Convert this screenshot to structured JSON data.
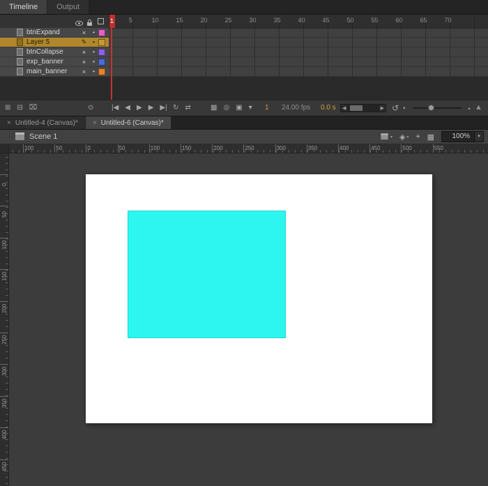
{
  "timeline": {
    "tabs": [
      {
        "label": "Timeline"
      },
      {
        "label": "Output"
      }
    ],
    "layers": [
      {
        "name": "btnExpand",
        "status_icon": "×",
        "dot": "•",
        "color": "#e060c8",
        "selected": false
      },
      {
        "name": "Layer 5",
        "status_icon": "✎",
        "dot": "•",
        "color": "#c49a35",
        "selected": true
      },
      {
        "name": "btnCollapse",
        "status_icon": "×",
        "dot": "•",
        "color": "#8f5fe8",
        "selected": false
      },
      {
        "name": "exp_banner",
        "status_icon": "×",
        "dot": "•",
        "color": "#4a6cd4",
        "selected": false
      },
      {
        "name": "main_banner",
        "status_icon": "×",
        "dot": "•",
        "color": "#e8822a",
        "selected": false
      }
    ],
    "frame_numbers": [
      5,
      10,
      15,
      20,
      25,
      30,
      35,
      40,
      45,
      50,
      55,
      60,
      65,
      70
    ],
    "status": {
      "current_frame": "1",
      "frame_rate": "24.00 fps",
      "elapsed_time": "0.0 s"
    }
  },
  "toolbar": {
    "left_group": [
      {
        "name": "new-layer-button",
        "glyph": "⊞"
      },
      {
        "name": "new-folder-button",
        "glyph": "⊟"
      },
      {
        "name": "delete-layer-button",
        "glyph": "⌧"
      }
    ],
    "marker_group": [
      {
        "name": "center-frame-button",
        "glyph": "⊙"
      }
    ],
    "playback_group": [
      {
        "name": "go-first-frame-button",
        "glyph": "|◀"
      },
      {
        "name": "step-back-button",
        "glyph": "◀"
      },
      {
        "name": "play-button",
        "glyph": "▶"
      },
      {
        "name": "step-forward-button",
        "glyph": "▶"
      },
      {
        "name": "go-last-frame-button",
        "glyph": "▶|"
      }
    ],
    "loop_group": [
      {
        "name": "loop-playback-button",
        "glyph": "↻"
      },
      {
        "name": "frame-range-button",
        "glyph": "⇄"
      }
    ],
    "onion_group": [
      {
        "name": "onion-skin-button",
        "glyph": "▩"
      },
      {
        "name": "onion-skin-outlines-button",
        "glyph": "◎"
      },
      {
        "name": "edit-multiple-frames-button",
        "glyph": "▣"
      },
      {
        "name": "modify-markers-button",
        "glyph": "▾"
      }
    ]
  },
  "document_tabs": [
    {
      "label": "Untitled-4 (Canvas)*",
      "close": "×",
      "active": false
    },
    {
      "label": "Untitled-6 (Canvas)*",
      "close": "×",
      "active": true
    }
  ],
  "edit_bar": {
    "scene_label": "Scene 1",
    "zoom_level": "100%"
  },
  "rulers": {
    "horizontal": [
      "100",
      "50",
      "0",
      "50",
      "100",
      "150",
      "200",
      "250",
      "300",
      "350",
      "400",
      "450",
      "500",
      "550"
    ],
    "vertical": [
      "0",
      "50",
      "100",
      "150",
      "200",
      "250",
      "300",
      "350",
      "400",
      "450"
    ]
  },
  "stage": {
    "background": "#ffffff",
    "shape_color": "#2cf6ef"
  },
  "colors": {
    "selected_layer": "#b0872c",
    "playhead": "#c23434",
    "panel_bg": "#3c3c3c"
  }
}
